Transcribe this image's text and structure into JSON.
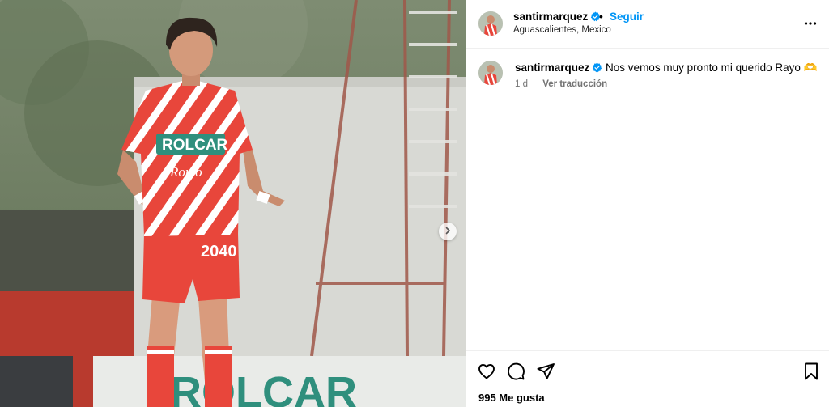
{
  "post": {
    "username": "santirmarquez",
    "follow_label": "Seguir",
    "separator": "•",
    "location": "Aguascalientes, Mexico",
    "caption": "Nos vemos muy pronto mi querido Rayo",
    "caption_emoji": "🫶",
    "time_ago": "1 d",
    "translate_label": "Ver traducción",
    "likes": "995 Me gusta"
  },
  "photo": {
    "jersey_sponsor": "ROLCAR",
    "jersey_sub": "Romo",
    "shorts_number": "2040",
    "banner_text": "ROLCAR",
    "shirt_color": "#e8463b",
    "verified_color": "#0095f6"
  },
  "icons": {
    "more": "more-options-icon",
    "next": "chevron-right-icon",
    "like": "heart-icon",
    "comment": "comment-icon",
    "share": "send-icon",
    "save": "bookmark-icon"
  }
}
